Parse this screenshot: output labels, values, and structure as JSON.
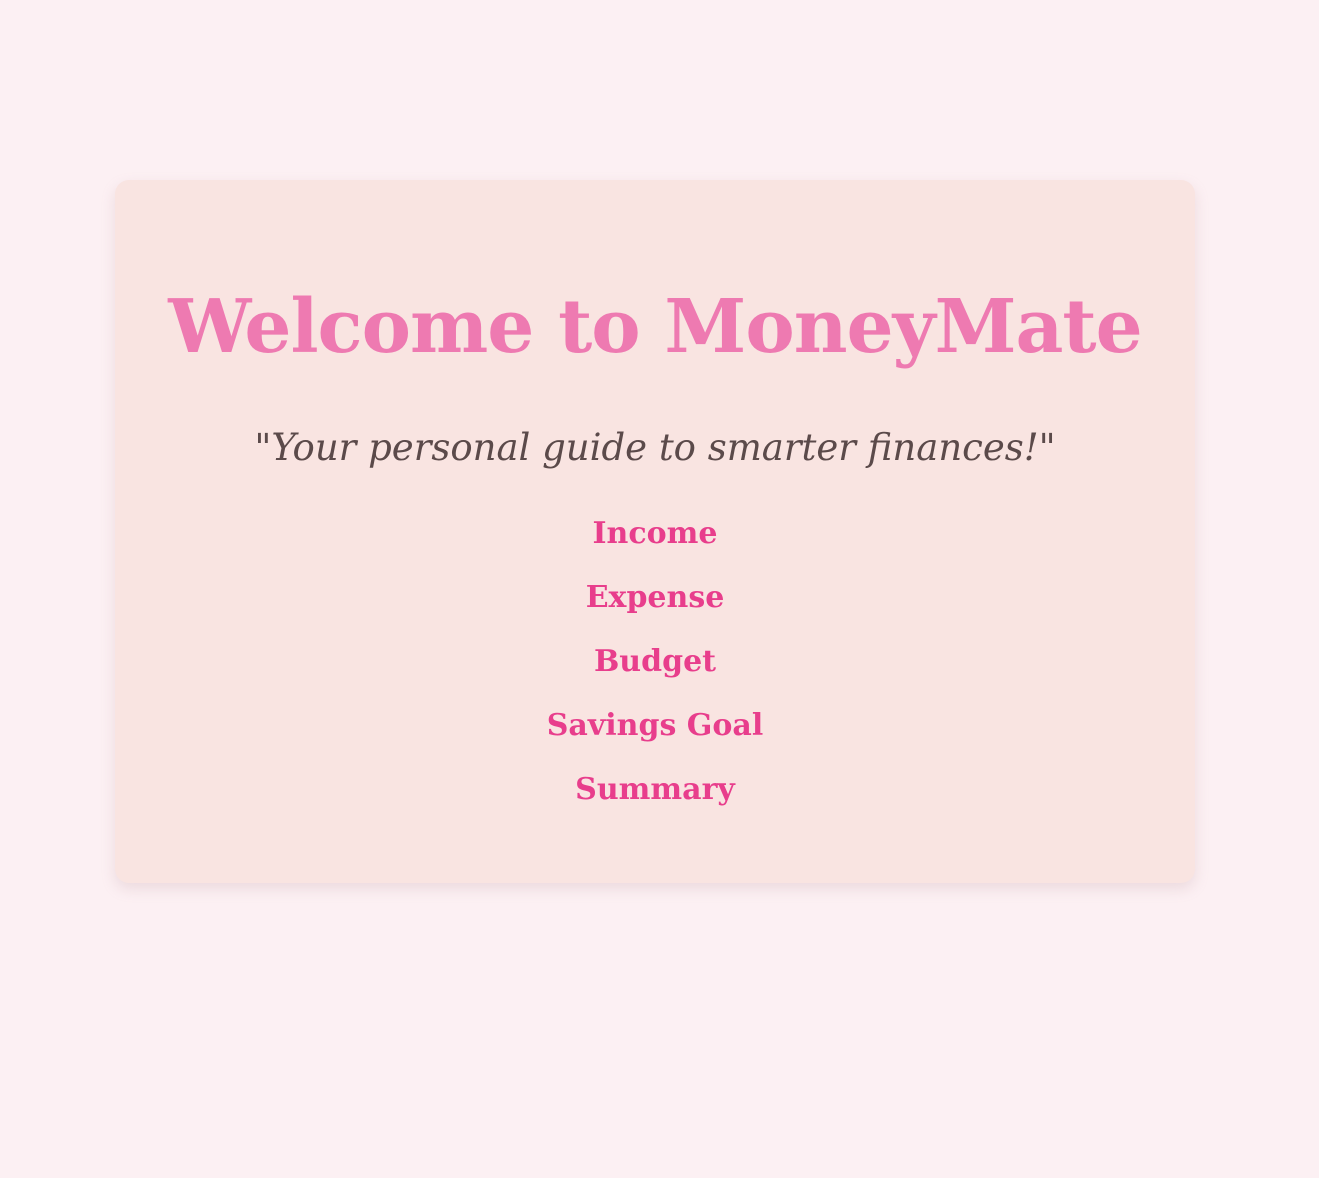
{
  "header": {
    "title": "Welcome to MoneyMate",
    "tagline": "\"Your personal guide to smarter finances!\""
  },
  "nav": {
    "items": [
      {
        "label": "Income"
      },
      {
        "label": "Expense"
      },
      {
        "label": "Budget"
      },
      {
        "label": "Savings Goal"
      },
      {
        "label": "Summary"
      }
    ]
  },
  "colors": {
    "background": "#fcf0f3",
    "card": "#f9e4e1",
    "title": "#ee7ab1",
    "link": "#e83e8c",
    "tagline": "#5b4a4a"
  }
}
